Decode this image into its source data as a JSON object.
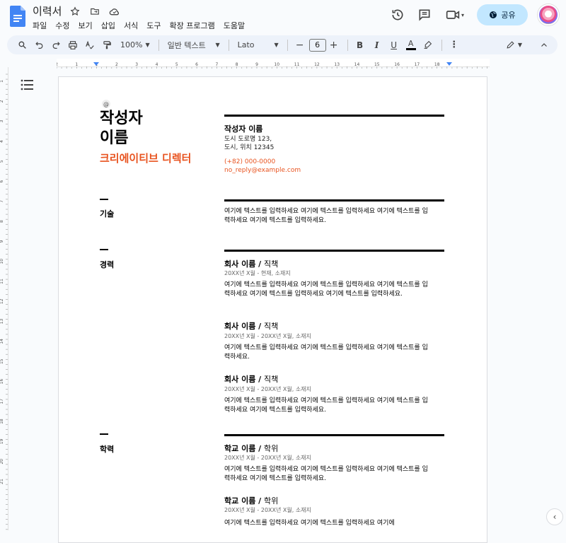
{
  "app": {
    "doc_title": "이력서",
    "menu": [
      "파일",
      "수정",
      "보기",
      "삽입",
      "서식",
      "도구",
      "확장 프로그램",
      "도움말"
    ],
    "share_label": "공유"
  },
  "toolbar": {
    "zoom": "100%",
    "style": "일반 텍스트",
    "font": "Lato",
    "font_size": "6",
    "bold": "B",
    "italic": "I",
    "underline": "U",
    "text_color": "A"
  },
  "ruler": {
    "labels": [
      "2",
      "1",
      "1",
      "2",
      "3",
      "4",
      "5",
      "6",
      "7",
      "8",
      "9",
      "10",
      "11",
      "12",
      "13",
      "14",
      "15",
      "16",
      "17",
      "18"
    ],
    "vlabels": [
      "1",
      "2",
      "3",
      "4",
      "5",
      "6",
      "7",
      "8",
      "9",
      "10",
      "11",
      "12",
      "13",
      "14",
      "15",
      "16",
      "17",
      "18",
      "19",
      "20",
      "21"
    ]
  },
  "resume": {
    "name_line1": "작성자",
    "name_line2": "이름",
    "role": "크리에이티브 디렉터",
    "contact_name": "작성자 이름",
    "address1": "도시 도로명 123,",
    "address2": "도시, 위치 12345",
    "phone": "(+82) 000-0000",
    "email": "no_reply@example.com",
    "skills_title": "기술",
    "skills_text": "여기에 텍스트를 입력하세요 여기에 텍스트를 입력하세요 여기에 텍스트를 입력하세요 여기에 텍스트를 입력하세요.",
    "experience_title": "경력",
    "jobs": [
      {
        "company": "회사 이름 / ",
        "title": "직책",
        "meta": "20XX년 X월 - 현재, 소재지",
        "desc": "여기에 텍스트를 입력하세요 여기에 텍스트를 입력하세요 여기에 텍스트를 입력하세요 여기에 텍스트를 입력하세요 여기에 텍스트를 입력하세요."
      },
      {
        "company": "회사 이름 / ",
        "title": "직책",
        "meta": "20XX년 X월 - 20XX년 X월, 소재지",
        "desc": "여기에 텍스트를 입력하세요 여기에 텍스트를 입력하세요 여기에 텍스트를 입력하세요."
      },
      {
        "company": "회사 이름 / ",
        "title": "직책",
        "meta": "20XX년 X월 - 20XX년 X월, 소재지",
        "desc": "여기에 텍스트를 입력하세요 여기에 텍스트를 입력하세요 여기에 텍스트를 입력하세요 여기에 텍스트를 입력하세요."
      }
    ],
    "education_title": "학력",
    "schools": [
      {
        "school": "학교 이름 / ",
        "degree": "학위",
        "meta": "20XX년 X월 - 20XX년 X월, 소재지",
        "desc": "여기에 텍스트를 입력하세요 여기에 텍스트를 입력하세요 여기에 텍스트를 입력하세요 여기에 텍스트를 입력하세요."
      },
      {
        "school": "학교 이름 / ",
        "degree": "학위",
        "meta": "20XX년 X월 - 20XX년 X월, 소재지",
        "desc": "여기에 텍스트를 입력하세요 여기에 텍스트를 입력하세요 여기에"
      }
    ]
  },
  "colors": {
    "accent": "#e8531f",
    "share_bg": "#c2e7ff",
    "toolbar_bg": "#edf2fa"
  }
}
